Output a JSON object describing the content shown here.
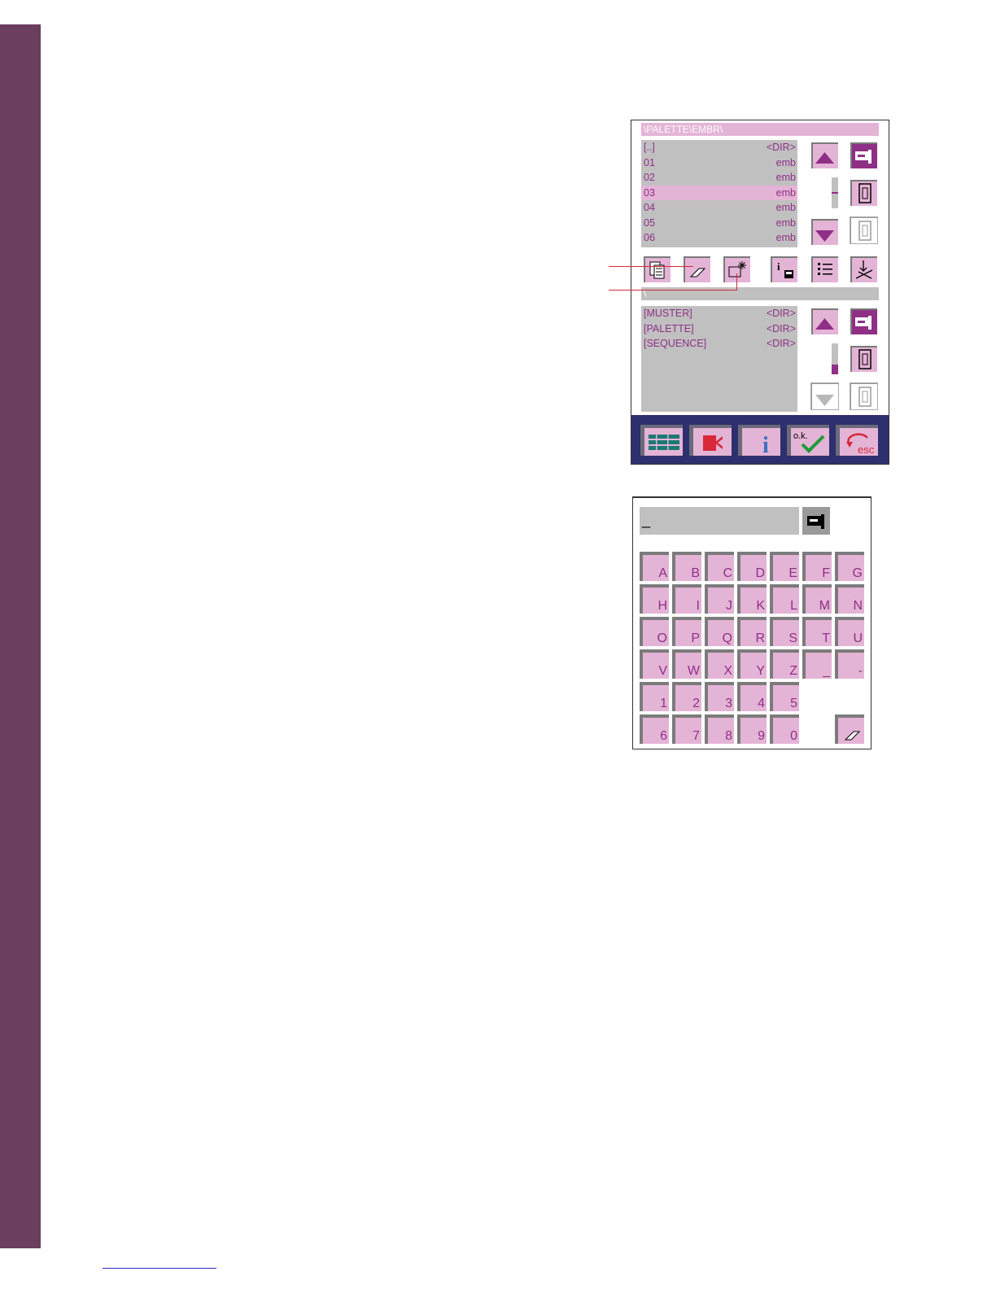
{
  "file_manager": {
    "top_path": "\\PALETTE\\EMBR\\",
    "top_files": [
      {
        "name": "[..]",
        "type": "<DIR>",
        "selected": false
      },
      {
        "name": "01",
        "type": "emb",
        "selected": false
      },
      {
        "name": "02",
        "type": "emb",
        "selected": false
      },
      {
        "name": "03",
        "type": "emb",
        "selected": true
      },
      {
        "name": "04",
        "type": "emb",
        "selected": false
      },
      {
        "name": "05",
        "type": "emb",
        "selected": false
      },
      {
        "name": "06",
        "type": "emb",
        "selected": false
      }
    ],
    "bottom_path": "\\",
    "bottom_files": [
      {
        "name": "[MUSTER]",
        "type": "<DIR>"
      },
      {
        "name": "[PALETTE]",
        "type": "<DIR>"
      },
      {
        "name": "[SEQUENCE]",
        "type": "<DIR>"
      }
    ],
    "icons": {
      "scroll_up": "arrow-up-icon",
      "scroll_down": "arrow-down-icon",
      "machine": "sewing-machine-icon",
      "card": "memory-card-icon",
      "copy": "copy-icon",
      "delete": "eraser-icon",
      "new_folder": "new-folder-icon",
      "info": "disk-info-icon",
      "list": "list-icon",
      "tools": "tools-icon"
    },
    "bottom_bar": {
      "menu": "menu-icon",
      "exit": "exit-icon",
      "info": "i",
      "ok": "o.k.",
      "esc": "esc"
    }
  },
  "keyboard": {
    "input_value": "_",
    "rows": [
      [
        "A",
        "B",
        "C",
        "D",
        "E",
        "F",
        "G"
      ],
      [
        "H",
        "I",
        "J",
        "K",
        "L",
        "M",
        "N"
      ],
      [
        "O",
        "P",
        "Q",
        "R",
        "S",
        "T",
        "U"
      ],
      [
        "V",
        "W",
        "X",
        "Y",
        "Z",
        "_",
        "-"
      ],
      [
        "1",
        "2",
        "3",
        "4",
        "5"
      ],
      [
        "6",
        "7",
        "8",
        "9",
        "0"
      ]
    ],
    "delete_icon": "eraser-icon"
  },
  "colors": {
    "accent_pink": "#e4b4d6",
    "accent_purple": "#8f2f86",
    "sidebar": "#6b3d5f",
    "bottom_bar": "#2e2f6e",
    "callout": "#d8283a"
  }
}
